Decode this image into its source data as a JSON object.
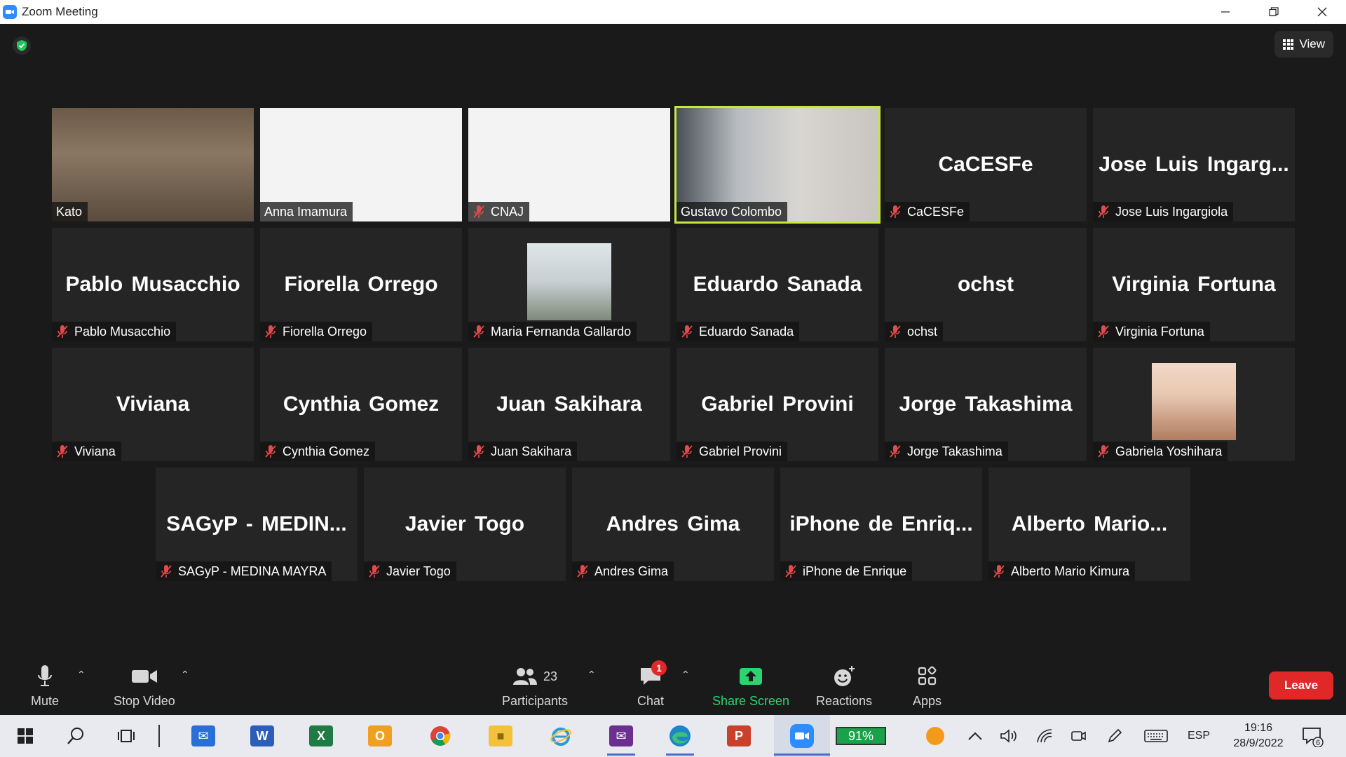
{
  "window": {
    "title": "Zoom Meeting"
  },
  "meeting": {
    "view_label": "View"
  },
  "participants": [
    {
      "big": "",
      "name": "Kato",
      "muted": false,
      "video": "kato"
    },
    {
      "big": "",
      "name": "Anna Imamura",
      "muted": false,
      "video": "white"
    },
    {
      "big": "",
      "name": "CNAJ",
      "muted": true,
      "video": "white"
    },
    {
      "big": "",
      "name": "Gustavo Colombo",
      "muted": false,
      "video": "gustavo",
      "speaking": true
    },
    {
      "big": "CaCESFe",
      "name": "CaCESFe",
      "muted": true
    },
    {
      "big": "Jose Luis Ingarg...",
      "name": "Jose Luis Ingargiola",
      "muted": true
    },
    {
      "big": "Pablo Musacchio",
      "name": "Pablo Musacchio",
      "muted": true
    },
    {
      "big": "Fiorella Orrego",
      "name": "Fiorella Orrego",
      "muted": true
    },
    {
      "big": "",
      "name": "Maria Fernanda Gallardo",
      "muted": true,
      "thumb": "maria"
    },
    {
      "big": "Eduardo Sanada",
      "name": "Eduardo Sanada",
      "muted": true
    },
    {
      "big": "ochst",
      "name": "ochst",
      "muted": true
    },
    {
      "big": "Virginia Fortuna",
      "name": "Virginia Fortuna",
      "muted": true
    },
    {
      "big": "Viviana",
      "name": "Viviana",
      "muted": true
    },
    {
      "big": "Cynthia Gomez",
      "name": "Cynthia Gomez",
      "muted": true
    },
    {
      "big": "Juan Sakihara",
      "name": "Juan Sakihara",
      "muted": true
    },
    {
      "big": "Gabriel Provini",
      "name": "Gabriel Provini",
      "muted": true
    },
    {
      "big": "Jorge Takashima",
      "name": "Jorge Takashima",
      "muted": true
    },
    {
      "big": "",
      "name": "Gabriela Yoshihara",
      "muted": true,
      "thumb": "gab"
    },
    {
      "big": "SAGyP - MEDIN...",
      "name": "SAGyP - MEDINA MAYRA",
      "muted": true
    },
    {
      "big": "Javier Togo",
      "name": "Javier Togo",
      "muted": true
    },
    {
      "big": "Andres Gima",
      "name": "Andres Gima",
      "muted": true
    },
    {
      "big": "iPhone de Enriq...",
      "name": "iPhone de Enrique",
      "muted": true
    },
    {
      "big": "Alberto Mario...",
      "name": "Alberto Mario Kimura",
      "muted": true
    }
  ],
  "toolbar": {
    "mute": "Mute",
    "stop_video": "Stop Video",
    "participants": "Participants",
    "participants_count": "23",
    "chat": "Chat",
    "chat_badge": "1",
    "share_screen": "Share Screen",
    "reactions": "Reactions",
    "apps": "Apps",
    "leave": "Leave"
  },
  "taskbar": {
    "battery": "91%",
    "language": "ESP",
    "time": "19:16",
    "date": "28/9/2022",
    "notifications": "6"
  },
  "colors": {
    "speaking": "#c6e83e",
    "leave": "#e02828",
    "share": "#2dd36f",
    "mute_red": "#e24b4b"
  }
}
